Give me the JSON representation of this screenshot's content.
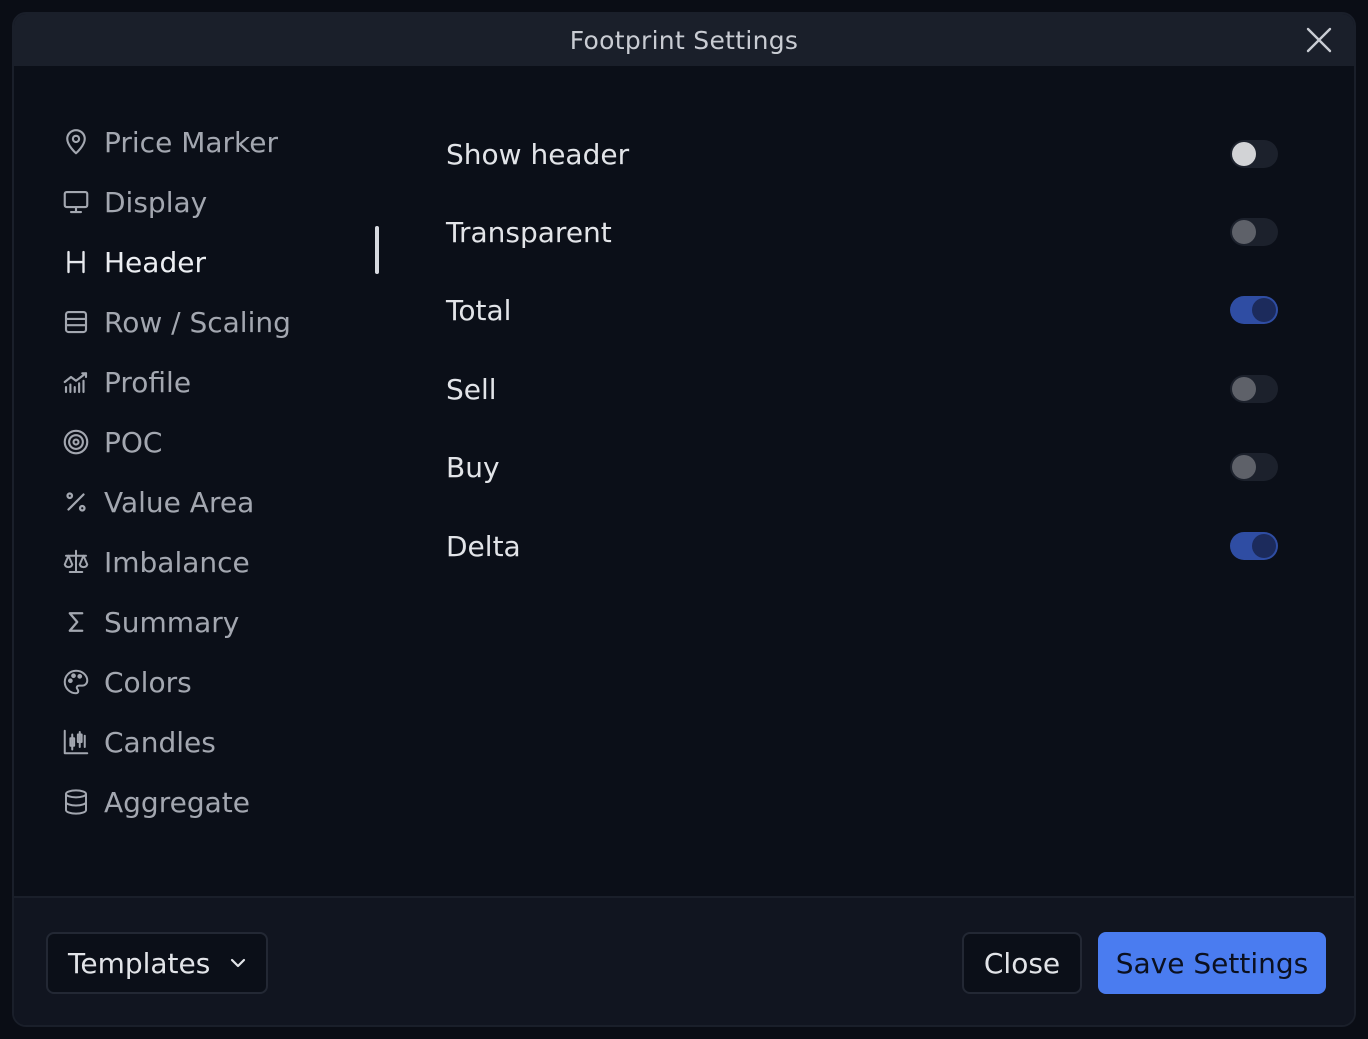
{
  "dialog": {
    "title": "Footprint Settings"
  },
  "sidebar": {
    "items": [
      {
        "label": "Price Marker",
        "icon": "map-pin-icon"
      },
      {
        "label": "Display",
        "icon": "monitor-icon"
      },
      {
        "label": "Header",
        "icon": "heading-icon",
        "active": true
      },
      {
        "label": "Row / Scaling",
        "icon": "rows-icon"
      },
      {
        "label": "Profile",
        "icon": "chart-profile-icon"
      },
      {
        "label": "POC",
        "icon": "target-icon"
      },
      {
        "label": "Value Area",
        "icon": "percent-icon"
      },
      {
        "label": "Imbalance",
        "icon": "scale-icon"
      },
      {
        "label": "Summary",
        "icon": "sigma-icon"
      },
      {
        "label": "Colors",
        "icon": "palette-icon"
      },
      {
        "label": "Candles",
        "icon": "candles-icon"
      },
      {
        "label": "Aggregate",
        "icon": "database-icon"
      }
    ]
  },
  "settings": {
    "rows": [
      {
        "label": "Show header",
        "on": false
      },
      {
        "label": "Transparent",
        "on": false
      },
      {
        "label": "Total",
        "on": true
      },
      {
        "label": "Sell",
        "on": false
      },
      {
        "label": "Buy",
        "on": false
      },
      {
        "label": "Delta",
        "on": true
      }
    ]
  },
  "footer": {
    "templates_label": "Templates",
    "close_label": "Close",
    "save_label": "Save Settings"
  },
  "colors": {
    "accent": "#4a7cf0",
    "toggle_on": "#2f4da3",
    "background": "#0b0f18",
    "titlebar": "#1a1f2a"
  }
}
